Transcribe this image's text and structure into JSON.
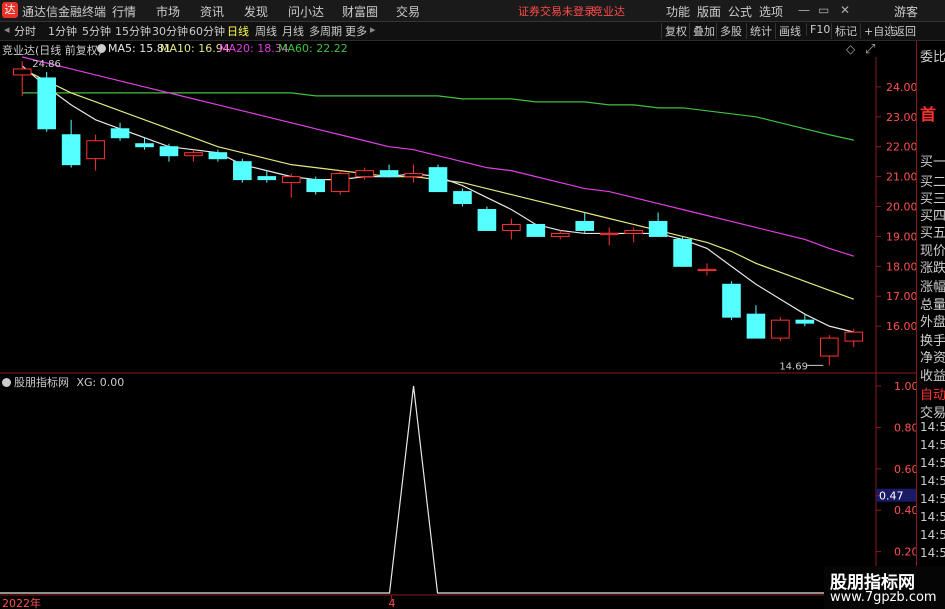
{
  "app": {
    "title": "通达信金融终端",
    "logo_glyph": "达"
  },
  "menu": [
    "行情",
    "市场",
    "资讯",
    "发现",
    "问小达",
    "财富圈",
    "交易"
  ],
  "warning": "证券交易未登录",
  "stock_name_top": "竞业达",
  "right_menu": [
    "功能",
    "版面",
    "公式",
    "选项"
  ],
  "window_buttons": {
    "min": "—",
    "restore": "▭",
    "close": "✕",
    "guest": "游客"
  },
  "period_tabs": [
    "分时",
    "1分钟",
    "5分钟",
    "15分钟",
    "30分钟",
    "60分钟",
    "日线",
    "周线",
    "月线",
    "多周期",
    "更多"
  ],
  "active_period": "日线",
  "tools": [
    "复权",
    "叠加",
    "多股",
    "统计",
    "画线",
    "F10",
    "标记",
    "+自选",
    "返回"
  ],
  "info": {
    "title": "竞业达(日线 前复权)",
    "ma5": "MA5: 15.81",
    "ma10": "MA10: 16.94",
    "ma20": "MA20: 18.34",
    "ma60": "MA60: 22.22"
  },
  "indicator": {
    "title": "股朋指标网",
    "xg": "XG: 0.00",
    "ticks": [
      "1.00",
      "0.80",
      "0.60",
      "0.47",
      "0.40",
      "0.20"
    ],
    "current_value": "0.47"
  },
  "price_axis": [
    "24.00",
    "23.00",
    "22.00",
    "21.00",
    "20.00",
    "19.00",
    "18.00",
    "17.00",
    "16.00"
  ],
  "annotations": {
    "high": "24.86",
    "low": "14.69"
  },
  "x_axis": {
    "start": "2022年",
    "mid": "4"
  },
  "right_panel": [
    "委比",
    "首",
    "买一",
    "买二",
    "买三",
    "买四",
    "买五",
    "现价",
    "涨跌",
    "涨幅",
    "总量",
    "外盘",
    "换手",
    "净资",
    "收益",
    "自动",
    "交易",
    "14:5",
    "14:5",
    "14:5",
    "14:5",
    "14:5",
    "14:5",
    "14:5",
    "14:5",
    "14:5",
    "14:5"
  ],
  "watermark": {
    "line1": "股朋指标网",
    "line2": "www.7gpzb.com"
  },
  "colors": {
    "up": "#ff3232",
    "down": "#54ffff",
    "ma5": "#e6e6e6",
    "ma10": "#e6e680",
    "ma20": "#e040e0",
    "ma60": "#40c040",
    "frame": "#8b1a1a"
  },
  "chart_data": {
    "type": "candlestick",
    "ylim": [
      14.5,
      25.0
    ],
    "candles": [
      {
        "o": 24.4,
        "h": 24.86,
        "l": 23.7,
        "c": 24.6
      },
      {
        "o": 24.3,
        "h": 24.5,
        "l": 22.5,
        "c": 22.6
      },
      {
        "o": 22.4,
        "h": 22.9,
        "l": 21.3,
        "c": 21.4
      },
      {
        "o": 21.6,
        "h": 22.4,
        "l": 21.2,
        "c": 22.2
      },
      {
        "o": 22.6,
        "h": 22.8,
        "l": 22.2,
        "c": 22.3
      },
      {
        "o": 22.1,
        "h": 22.3,
        "l": 21.9,
        "c": 22.0
      },
      {
        "o": 22.0,
        "h": 22.1,
        "l": 21.5,
        "c": 21.7
      },
      {
        "o": 21.7,
        "h": 21.9,
        "l": 21.5,
        "c": 21.8
      },
      {
        "o": 21.8,
        "h": 21.9,
        "l": 21.5,
        "c": 21.6
      },
      {
        "o": 21.5,
        "h": 21.6,
        "l": 20.8,
        "c": 20.9
      },
      {
        "o": 21.0,
        "h": 21.2,
        "l": 20.8,
        "c": 20.9
      },
      {
        "o": 20.8,
        "h": 21.1,
        "l": 20.3,
        "c": 21.0
      },
      {
        "o": 20.9,
        "h": 21.0,
        "l": 20.4,
        "c": 20.5
      },
      {
        "o": 20.5,
        "h": 21.2,
        "l": 20.4,
        "c": 21.1
      },
      {
        "o": 21.0,
        "h": 21.3,
        "l": 20.9,
        "c": 21.2
      },
      {
        "o": 21.2,
        "h": 21.4,
        "l": 21.0,
        "c": 21.0
      },
      {
        "o": 21.0,
        "h": 21.4,
        "l": 20.8,
        "c": 21.1
      },
      {
        "o": 21.3,
        "h": 21.4,
        "l": 20.5,
        "c": 20.5
      },
      {
        "o": 20.5,
        "h": 20.6,
        "l": 20.0,
        "c": 20.1
      },
      {
        "o": 19.9,
        "h": 20.0,
        "l": 19.2,
        "c": 19.2
      },
      {
        "o": 19.2,
        "h": 19.6,
        "l": 18.9,
        "c": 19.4
      },
      {
        "o": 19.4,
        "h": 19.4,
        "l": 19.0,
        "c": 19.0
      },
      {
        "o": 19.0,
        "h": 19.2,
        "l": 18.9,
        "c": 19.1
      },
      {
        "o": 19.5,
        "h": 19.8,
        "l": 19.1,
        "c": 19.2
      },
      {
        "o": 19.1,
        "h": 19.3,
        "l": 18.7,
        "c": 19.1
      },
      {
        "o": 19.1,
        "h": 19.3,
        "l": 18.8,
        "c": 19.2
      },
      {
        "o": 19.5,
        "h": 19.8,
        "l": 19.0,
        "c": 19.0
      },
      {
        "o": 18.9,
        "h": 19.0,
        "l": 18.0,
        "c": 18.0
      },
      {
        "o": 17.9,
        "h": 18.1,
        "l": 17.7,
        "c": 17.9
      },
      {
        "o": 17.4,
        "h": 17.5,
        "l": 16.2,
        "c": 16.3
      },
      {
        "o": 16.4,
        "h": 16.7,
        "l": 15.6,
        "c": 15.6
      },
      {
        "o": 15.6,
        "h": 16.3,
        "l": 15.5,
        "c": 16.2
      },
      {
        "o": 16.2,
        "h": 16.4,
        "l": 16.0,
        "c": 16.1
      },
      {
        "o": 15.0,
        "h": 15.7,
        "l": 14.69,
        "c": 15.6
      },
      {
        "o": 15.5,
        "h": 15.9,
        "l": 15.3,
        "c": 15.8
      }
    ],
    "ma5": [
      24.7,
      24.0,
      23.4,
      22.9,
      22.6,
      22.3,
      22.0,
      21.9,
      21.8,
      21.4,
      21.2,
      21.0,
      20.9,
      20.9,
      21.0,
      21.0,
      21.1,
      21.0,
      20.7,
      20.3,
      19.9,
      19.4,
      19.2,
      19.1,
      19.1,
      19.1,
      19.1,
      18.9,
      18.6,
      18.0,
      17.4,
      16.9,
      16.4,
      16.0,
      15.8
    ],
    "ma10": [
      24.6,
      24.2,
      23.8,
      23.5,
      23.2,
      22.9,
      22.6,
      22.3,
      22.0,
      21.8,
      21.6,
      21.4,
      21.3,
      21.2,
      21.1,
      21.0,
      21.0,
      20.9,
      20.8,
      20.6,
      20.4,
      20.2,
      20.0,
      19.8,
      19.6,
      19.4,
      19.2,
      19.0,
      18.8,
      18.5,
      18.1,
      17.8,
      17.5,
      17.2,
      16.9
    ],
    "ma20": [
      25.0,
      24.8,
      24.6,
      24.4,
      24.2,
      24.0,
      23.8,
      23.6,
      23.4,
      23.2,
      23.0,
      22.8,
      22.6,
      22.4,
      22.2,
      22.0,
      21.9,
      21.7,
      21.5,
      21.3,
      21.2,
      21.0,
      20.8,
      20.6,
      20.5,
      20.3,
      20.1,
      19.9,
      19.7,
      19.5,
      19.3,
      19.1,
      18.9,
      18.6,
      18.34
    ],
    "ma60": [
      23.8,
      23.8,
      23.8,
      23.8,
      23.8,
      23.8,
      23.8,
      23.8,
      23.8,
      23.8,
      23.8,
      23.8,
      23.7,
      23.7,
      23.7,
      23.7,
      23.7,
      23.7,
      23.6,
      23.6,
      23.6,
      23.5,
      23.5,
      23.5,
      23.4,
      23.4,
      23.3,
      23.3,
      23.2,
      23.1,
      23.0,
      22.8,
      22.6,
      22.4,
      22.22
    ],
    "indicator_spike": {
      "index": 16,
      "value": 1.0
    }
  }
}
